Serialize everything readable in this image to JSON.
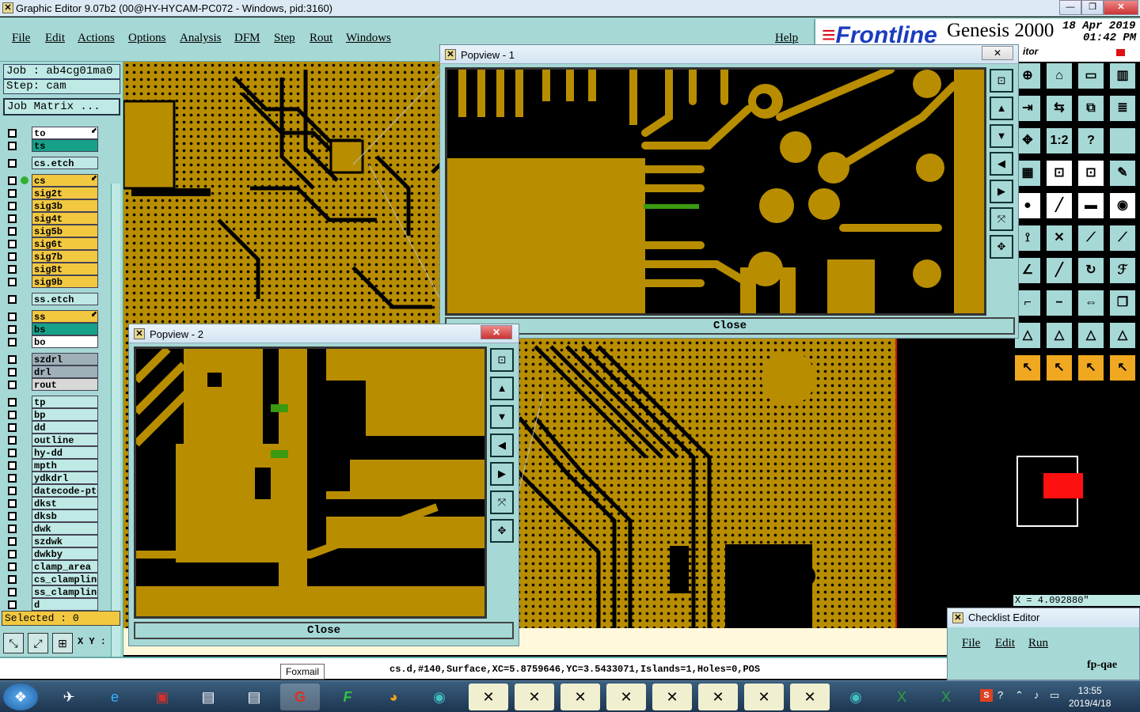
{
  "window": {
    "title": "Graphic Editor 9.07b2 (00@HY-HYCAM-PC072 - Windows, pid:3160)"
  },
  "menu": [
    "File",
    "Edit",
    "Actions",
    "Options",
    "Analysis",
    "DFM",
    "Step",
    "Rout",
    "Windows"
  ],
  "help": "Help",
  "brand": {
    "logo_text": "Frontline",
    "product": "Genesis 2000",
    "date": "18 Apr 2019",
    "time": "01:42 PM",
    "subtitle": "itor"
  },
  "job": {
    "job_label": "Job : ab4cg01ma0",
    "step_label": "Step: cam",
    "matrix_button": "Job Matrix ..."
  },
  "layers": [
    {
      "name": "to",
      "color": "#ffffff",
      "arrow": true
    },
    {
      "name": "ts",
      "color": "#17a08a",
      "arrow": false
    },
    {
      "name": "cs.etch",
      "color": "#bfe9e5",
      "arrow": false
    },
    {
      "name": "cs",
      "color": "#f2c840",
      "arrow": true
    },
    {
      "name": "sig2t",
      "color": "#f2c840",
      "arrow": false
    },
    {
      "name": "sig3b",
      "color": "#f2c840",
      "arrow": false
    },
    {
      "name": "sig4t",
      "color": "#f2c840",
      "arrow": false
    },
    {
      "name": "sig5b",
      "color": "#f2c840",
      "arrow": false
    },
    {
      "name": "sig6t",
      "color": "#f2c840",
      "arrow": false
    },
    {
      "name": "sig7b",
      "color": "#f2c840",
      "arrow": false
    },
    {
      "name": "sig8t",
      "color": "#f2c840",
      "arrow": false
    },
    {
      "name": "sig9b",
      "color": "#f2c840",
      "arrow": false
    },
    {
      "name": "ss.etch",
      "color": "#bfe9e5",
      "arrow": false
    },
    {
      "name": "ss",
      "color": "#f2c840",
      "arrow": true
    },
    {
      "name": "bs",
      "color": "#17a08a",
      "arrow": false
    },
    {
      "name": "bo",
      "color": "#ffffff",
      "arrow": false
    },
    {
      "name": "szdrl",
      "color": "#9fb0b8",
      "arrow": false
    },
    {
      "name": "drl",
      "color": "#9fb0b8",
      "arrow": false
    },
    {
      "name": "rout",
      "color": "#d8d8d8",
      "arrow": false
    },
    {
      "name": "tp",
      "color": "#bfe9e5",
      "arrow": false
    },
    {
      "name": "bp",
      "color": "#bfe9e5",
      "arrow": false
    },
    {
      "name": "dd",
      "color": "#bfe9e5",
      "arrow": false
    },
    {
      "name": "outline",
      "color": "#bfe9e5",
      "arrow": false
    },
    {
      "name": "hy-dd",
      "color": "#bfe9e5",
      "arrow": false
    },
    {
      "name": "mpth",
      "color": "#bfe9e5",
      "arrow": false
    },
    {
      "name": "ydkdrl",
      "color": "#bfe9e5",
      "arrow": false
    },
    {
      "name": "datecode-pto",
      "color": "#bfe9e5",
      "arrow": false
    },
    {
      "name": "dkst",
      "color": "#bfe9e5",
      "arrow": false
    },
    {
      "name": "dksb",
      "color": "#bfe9e5",
      "arrow": false
    },
    {
      "name": "dwk",
      "color": "#bfe9e5",
      "arrow": false
    },
    {
      "name": "szdwk",
      "color": "#bfe9e5",
      "arrow": false
    },
    {
      "name": "dwkby",
      "color": "#bfe9e5",
      "arrow": false
    },
    {
      "name": "clamp_area",
      "color": "#bfe9e5",
      "arrow": false
    },
    {
      "name": "cs_clampline",
      "color": "#bfe9e5",
      "arrow": false
    },
    {
      "name": "ss_clampline",
      "color": "#bfe9e5",
      "arrow": false
    },
    {
      "name": "d",
      "color": "#bfe9e5",
      "arrow": false
    }
  ],
  "selected": "Selected : 0",
  "xy_label": "X Y :",
  "coord_readout": "X = 4.092880\"",
  "status": "cs.d,#140,Surface,XC=5.8759646,YC=3.5433071,Islands=1,Holes=0,POS",
  "popview1": {
    "title": "Popview - 1",
    "close": "Close"
  },
  "popview2": {
    "title": "Popview - 2",
    "close": "Close"
  },
  "tooltip": "Foxmail",
  "checklist": {
    "title": "Checklist Editor",
    "menu": [
      "File",
      "Edit",
      "Run"
    ],
    "item": "fp-qae"
  },
  "clock": {
    "time": "13:55",
    "date": "2019/4/18"
  }
}
